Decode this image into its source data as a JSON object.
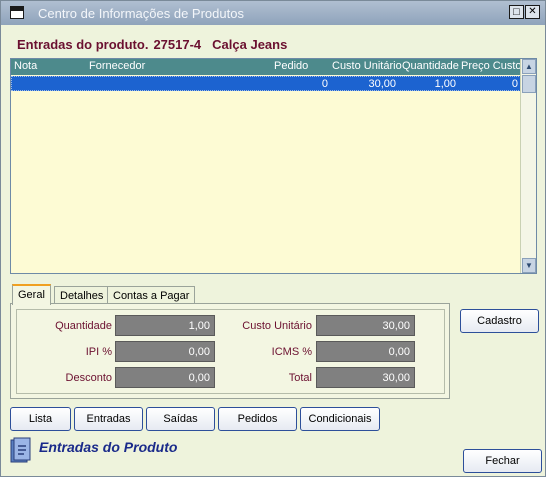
{
  "window": {
    "title": "Centro de Informações de Produtos"
  },
  "header": {
    "label": "Entradas do produto.",
    "product_code": "27517-4",
    "product_name": "Calça Jeans"
  },
  "grid": {
    "columns": [
      "Nota",
      "Fornecedor",
      "Pedido",
      "Custo Unitário",
      "Quantidade",
      "Preço Custo"
    ],
    "rows": [
      {
        "nota": "",
        "fornecedor": "",
        "pedido": "0",
        "custo_unitario": "30,00",
        "quantidade": "1,00",
        "preco_custo": "0"
      }
    ]
  },
  "tabs": [
    {
      "label": "Geral",
      "active": true
    },
    {
      "label": "Detalhes"
    },
    {
      "label": "Contas a Pagar"
    }
  ],
  "fields": {
    "quantidade": {
      "label": "Quantidade",
      "value": "1,00"
    },
    "ipi": {
      "label": "IPI %",
      "value": "0,00"
    },
    "desconto": {
      "label": "Desconto",
      "value": "0,00"
    },
    "custo_unitario": {
      "label": "Custo Unitário",
      "value": "30,00"
    },
    "icms": {
      "label": "ICMS %",
      "value": "0,00"
    },
    "total": {
      "label": "Total",
      "value": "30,00"
    }
  },
  "buttons": {
    "cadastro": "Cadastro",
    "lista": "Lista",
    "entradas": "Entradas",
    "saidas": "Saídas",
    "pedidos": "Pedidos",
    "condicionais": "Condicionais",
    "fechar": "Fechar"
  },
  "footer": {
    "title": "Entradas do Produto"
  },
  "icons": [
    "window-menu-icon",
    "minimize-maximize-icon",
    "close-icon",
    "scroll-up-icon",
    "scroll-down-icon",
    "product-entries-icon"
  ],
  "colors": {
    "background": "#eef3dc",
    "grid_bg": "#fdfbd4",
    "grid_header": "#4d8a8c",
    "selected_row": "#1c63d0",
    "accent_text": "#6b1030",
    "footer_text": "#1a2a8a"
  }
}
